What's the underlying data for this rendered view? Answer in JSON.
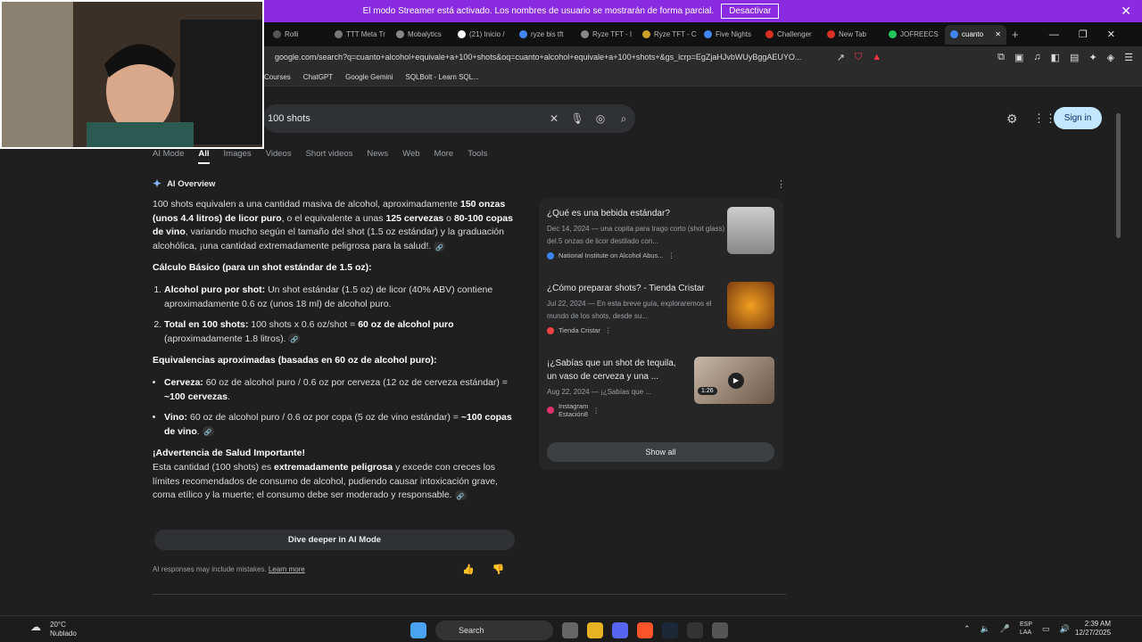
{
  "streamer": {
    "message": "El modo Streamer está activado. Los nombres de usuario se mostrarán de forma parcial.",
    "button": "Desactivar"
  },
  "tabs": [
    {
      "label": "Rolli",
      "color": "#555"
    },
    {
      "label": "TTT Meta Tr",
      "color": "#777"
    },
    {
      "label": "Mobalytics",
      "color": "#888"
    },
    {
      "label": "(21) Inicio /",
      "color": "#fff"
    },
    {
      "label": "ryze bis tft",
      "color": "#4285f4"
    },
    {
      "label": "Ryze TFT - I",
      "color": "#888"
    },
    {
      "label": "Ryze TFT - C",
      "color": "#c9a227"
    },
    {
      "label": "Five Nights",
      "color": "#4285f4"
    },
    {
      "label": "Challenger",
      "color": "#d93025"
    },
    {
      "label": "New Tab",
      "color": "#d93025"
    },
    {
      "label": "JOFREECS",
      "color": "#22c55e"
    },
    {
      "label": "cuanto",
      "color": "#4285f4",
      "active": true
    }
  ],
  "address": {
    "url": "google.com/search?q=cuanto+alcohol+equivale+a+100+shots&oq=cuanto+alcohol+equivale+a+100+shots+&gs_lcrp=EgZjaHJvbWUyBggAEUYO..."
  },
  "bookmarks": [
    "Courses",
    "ChatGPT",
    "Google Gemini",
    "SQLBolt - Learn SQL..."
  ],
  "search": {
    "query": "100 shots",
    "sign_in": "Sign in"
  },
  "nav": [
    "AI Mode",
    "All",
    "Images",
    "Videos",
    "Short videos",
    "News",
    "Web",
    "More",
    "Tools"
  ],
  "ai": {
    "title": "AI Overview",
    "intro": "100 shots equivalen a una cantidad masiva de alcohol, aproximadamente ",
    "intro_b1": "150 onzas (unos 4.4 litros) de licor puro",
    "intro_2": ", o el equivalente a unas ",
    "intro_b2": "125 cervezas",
    "intro_3": " o ",
    "intro_b3": "80-100 copas de vino",
    "intro_4": ", variando mucho según el tamaño del shot (1.5 oz estándar) y la graduación alcohólica, ¡una cantidad extremadamente peligrosa para la salud!.",
    "h1": "Cálculo Básico (para un shot estándar de 1.5 oz):",
    "li1_b": "Alcohol puro por shot:",
    "li1": " Un shot estándar (1.5 oz) de licor (40% ABV) contiene aproximadamente 0.6 oz (unos 18 ml) de alcohol puro.",
    "li2_b": "Total en 100 shots:",
    "li2": " 100 shots x 0.6 oz/shot = ",
    "li2_b2": "60 oz de alcohol puro",
    "li2_end": " (aproximadamente 1.8 litros).",
    "h2": "Equivalencias aproximadas (basadas en 60 oz de alcohol puro):",
    "b1_b": "Cerveza:",
    "b1": " 60 oz de alcohol puro / 0.6 oz por cerveza (12 oz de cerveza estándar) = ",
    "b1_b2": "~100 cervezas",
    "b2_b": "Vino:",
    "b2": " 60 oz de alcohol puro / 0.6 oz por copa (5 oz de vino estándar) = ",
    "b2_b2": "~100 copas de vino",
    "h3": "¡Advertencia de Salud Importante!",
    "warn1": "Esta cantidad (100 shots) es ",
    "warn_b": "extremadamente peligrosa",
    "warn2": " y excede con creces los límites recomendados de consumo de alcohol, pudiendo causar intoxicación grave, coma etílico y la muerte; el consumo debe ser moderado y responsable.",
    "dive": "Dive deeper in AI Mode",
    "disclaimer": "AI responses may include mistakes.",
    "learn": "Learn more"
  },
  "sources": [
    {
      "title": "¿Qué es una bebida estándar?",
      "desc": "Dec 14, 2024 — una copita para trago corto (shot glass) del.5 onzas de licor destilado con...",
      "site": "National Institute on Alcohol Abus...",
      "color": "#3b82f6"
    },
    {
      "title": "¿Cómo preparar shots? - Tienda Cristar",
      "desc": "Jul 22, 2024 — En esta breve guía, exploraremos el mundo de los shots, desde su...",
      "site": "Tienda Cristar",
      "color": "#ef4444"
    },
    {
      "title": "¡¿Sabías que un shot de tequila, un vaso de cerveza y una ...",
      "desc": "Aug 22, 2024 — ¡¿Sabías que ...",
      "site": "Instagram",
      "sub": "Estación8",
      "color": "#e1306c",
      "duration": "1:26"
    }
  ],
  "show_all": "Show all",
  "taskbar": {
    "temp": "20°C",
    "weather": "Nublado",
    "search": "Search",
    "lang1": "ESP",
    "lang2": "LAA",
    "time": "2:39 AM",
    "date": "12/27/2025"
  }
}
